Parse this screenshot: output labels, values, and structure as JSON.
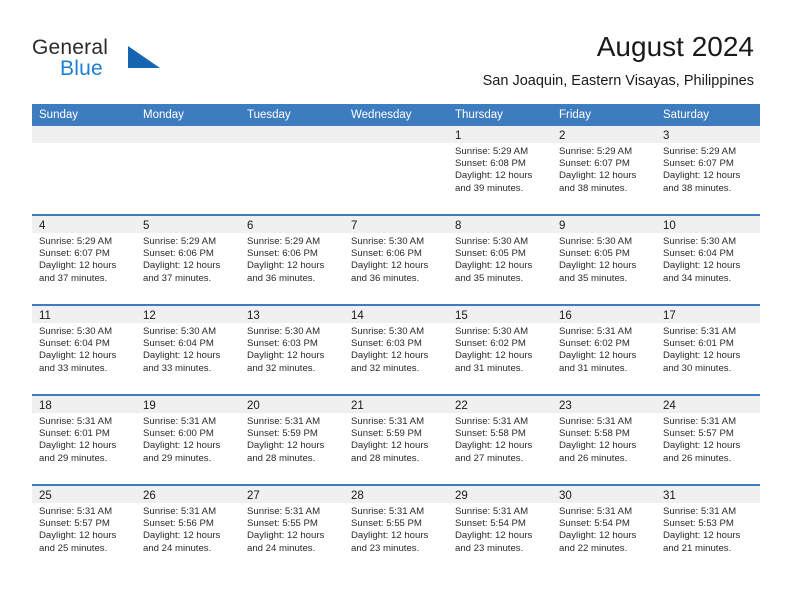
{
  "brand": {
    "line1": "General",
    "line2": "Blue",
    "logo_icon": "blue-triangle-icon",
    "accent_color": "#1f7fd0",
    "triangle_color": "#1565b0"
  },
  "header": {
    "title": "August 2024",
    "subtitle": "San Joaquin, Eastern Visayas, Philippines"
  },
  "calendar": {
    "header_bg": "#3d7cbf",
    "weekdays": [
      "Sunday",
      "Monday",
      "Tuesday",
      "Wednesday",
      "Thursday",
      "Friday",
      "Saturday"
    ],
    "weeks": [
      [
        {
          "day": "",
          "empty": true,
          "sunrise": "",
          "sunset": "",
          "daylight_line1": "",
          "daylight_line2": ""
        },
        {
          "day": "",
          "empty": true,
          "sunrise": "",
          "sunset": "",
          "daylight_line1": "",
          "daylight_line2": ""
        },
        {
          "day": "",
          "empty": true,
          "sunrise": "",
          "sunset": "",
          "daylight_line1": "",
          "daylight_line2": ""
        },
        {
          "day": "",
          "empty": true,
          "sunrise": "",
          "sunset": "",
          "daylight_line1": "",
          "daylight_line2": ""
        },
        {
          "day": "1",
          "empty": false,
          "sunrise": "Sunrise: 5:29 AM",
          "sunset": "Sunset: 6:08 PM",
          "daylight_line1": "Daylight: 12 hours",
          "daylight_line2": "and 39 minutes."
        },
        {
          "day": "2",
          "empty": false,
          "sunrise": "Sunrise: 5:29 AM",
          "sunset": "Sunset: 6:07 PM",
          "daylight_line1": "Daylight: 12 hours",
          "daylight_line2": "and 38 minutes."
        },
        {
          "day": "3",
          "empty": false,
          "sunrise": "Sunrise: 5:29 AM",
          "sunset": "Sunset: 6:07 PM",
          "daylight_line1": "Daylight: 12 hours",
          "daylight_line2": "and 38 minutes."
        }
      ],
      [
        {
          "day": "4",
          "empty": false,
          "sunrise": "Sunrise: 5:29 AM",
          "sunset": "Sunset: 6:07 PM",
          "daylight_line1": "Daylight: 12 hours",
          "daylight_line2": "and 37 minutes."
        },
        {
          "day": "5",
          "empty": false,
          "sunrise": "Sunrise: 5:29 AM",
          "sunset": "Sunset: 6:06 PM",
          "daylight_line1": "Daylight: 12 hours",
          "daylight_line2": "and 37 minutes."
        },
        {
          "day": "6",
          "empty": false,
          "sunrise": "Sunrise: 5:29 AM",
          "sunset": "Sunset: 6:06 PM",
          "daylight_line1": "Daylight: 12 hours",
          "daylight_line2": "and 36 minutes."
        },
        {
          "day": "7",
          "empty": false,
          "sunrise": "Sunrise: 5:30 AM",
          "sunset": "Sunset: 6:06 PM",
          "daylight_line1": "Daylight: 12 hours",
          "daylight_line2": "and 36 minutes."
        },
        {
          "day": "8",
          "empty": false,
          "sunrise": "Sunrise: 5:30 AM",
          "sunset": "Sunset: 6:05 PM",
          "daylight_line1": "Daylight: 12 hours",
          "daylight_line2": "and 35 minutes."
        },
        {
          "day": "9",
          "empty": false,
          "sunrise": "Sunrise: 5:30 AM",
          "sunset": "Sunset: 6:05 PM",
          "daylight_line1": "Daylight: 12 hours",
          "daylight_line2": "and 35 minutes."
        },
        {
          "day": "10",
          "empty": false,
          "sunrise": "Sunrise: 5:30 AM",
          "sunset": "Sunset: 6:04 PM",
          "daylight_line1": "Daylight: 12 hours",
          "daylight_line2": "and 34 minutes."
        }
      ],
      [
        {
          "day": "11",
          "empty": false,
          "sunrise": "Sunrise: 5:30 AM",
          "sunset": "Sunset: 6:04 PM",
          "daylight_line1": "Daylight: 12 hours",
          "daylight_line2": "and 33 minutes."
        },
        {
          "day": "12",
          "empty": false,
          "sunrise": "Sunrise: 5:30 AM",
          "sunset": "Sunset: 6:04 PM",
          "daylight_line1": "Daylight: 12 hours",
          "daylight_line2": "and 33 minutes."
        },
        {
          "day": "13",
          "empty": false,
          "sunrise": "Sunrise: 5:30 AM",
          "sunset": "Sunset: 6:03 PM",
          "daylight_line1": "Daylight: 12 hours",
          "daylight_line2": "and 32 minutes."
        },
        {
          "day": "14",
          "empty": false,
          "sunrise": "Sunrise: 5:30 AM",
          "sunset": "Sunset: 6:03 PM",
          "daylight_line1": "Daylight: 12 hours",
          "daylight_line2": "and 32 minutes."
        },
        {
          "day": "15",
          "empty": false,
          "sunrise": "Sunrise: 5:30 AM",
          "sunset": "Sunset: 6:02 PM",
          "daylight_line1": "Daylight: 12 hours",
          "daylight_line2": "and 31 minutes."
        },
        {
          "day": "16",
          "empty": false,
          "sunrise": "Sunrise: 5:31 AM",
          "sunset": "Sunset: 6:02 PM",
          "daylight_line1": "Daylight: 12 hours",
          "daylight_line2": "and 31 minutes."
        },
        {
          "day": "17",
          "empty": false,
          "sunrise": "Sunrise: 5:31 AM",
          "sunset": "Sunset: 6:01 PM",
          "daylight_line1": "Daylight: 12 hours",
          "daylight_line2": "and 30 minutes."
        }
      ],
      [
        {
          "day": "18",
          "empty": false,
          "sunrise": "Sunrise: 5:31 AM",
          "sunset": "Sunset: 6:01 PM",
          "daylight_line1": "Daylight: 12 hours",
          "daylight_line2": "and 29 minutes."
        },
        {
          "day": "19",
          "empty": false,
          "sunrise": "Sunrise: 5:31 AM",
          "sunset": "Sunset: 6:00 PM",
          "daylight_line1": "Daylight: 12 hours",
          "daylight_line2": "and 29 minutes."
        },
        {
          "day": "20",
          "empty": false,
          "sunrise": "Sunrise: 5:31 AM",
          "sunset": "Sunset: 5:59 PM",
          "daylight_line1": "Daylight: 12 hours",
          "daylight_line2": "and 28 minutes."
        },
        {
          "day": "21",
          "empty": false,
          "sunrise": "Sunrise: 5:31 AM",
          "sunset": "Sunset: 5:59 PM",
          "daylight_line1": "Daylight: 12 hours",
          "daylight_line2": "and 28 minutes."
        },
        {
          "day": "22",
          "empty": false,
          "sunrise": "Sunrise: 5:31 AM",
          "sunset": "Sunset: 5:58 PM",
          "daylight_line1": "Daylight: 12 hours",
          "daylight_line2": "and 27 minutes."
        },
        {
          "day": "23",
          "empty": false,
          "sunrise": "Sunrise: 5:31 AM",
          "sunset": "Sunset: 5:58 PM",
          "daylight_line1": "Daylight: 12 hours",
          "daylight_line2": "and 26 minutes."
        },
        {
          "day": "24",
          "empty": false,
          "sunrise": "Sunrise: 5:31 AM",
          "sunset": "Sunset: 5:57 PM",
          "daylight_line1": "Daylight: 12 hours",
          "daylight_line2": "and 26 minutes."
        }
      ],
      [
        {
          "day": "25",
          "empty": false,
          "sunrise": "Sunrise: 5:31 AM",
          "sunset": "Sunset: 5:57 PM",
          "daylight_line1": "Daylight: 12 hours",
          "daylight_line2": "and 25 minutes."
        },
        {
          "day": "26",
          "empty": false,
          "sunrise": "Sunrise: 5:31 AM",
          "sunset": "Sunset: 5:56 PM",
          "daylight_line1": "Daylight: 12 hours",
          "daylight_line2": "and 24 minutes."
        },
        {
          "day": "27",
          "empty": false,
          "sunrise": "Sunrise: 5:31 AM",
          "sunset": "Sunset: 5:55 PM",
          "daylight_line1": "Daylight: 12 hours",
          "daylight_line2": "and 24 minutes."
        },
        {
          "day": "28",
          "empty": false,
          "sunrise": "Sunrise: 5:31 AM",
          "sunset": "Sunset: 5:55 PM",
          "daylight_line1": "Daylight: 12 hours",
          "daylight_line2": "and 23 minutes."
        },
        {
          "day": "29",
          "empty": false,
          "sunrise": "Sunrise: 5:31 AM",
          "sunset": "Sunset: 5:54 PM",
          "daylight_line1": "Daylight: 12 hours",
          "daylight_line2": "and 23 minutes."
        },
        {
          "day": "30",
          "empty": false,
          "sunrise": "Sunrise: 5:31 AM",
          "sunset": "Sunset: 5:54 PM",
          "daylight_line1": "Daylight: 12 hours",
          "daylight_line2": "and 22 minutes."
        },
        {
          "day": "31",
          "empty": false,
          "sunrise": "Sunrise: 5:31 AM",
          "sunset": "Sunset: 5:53 PM",
          "daylight_line1": "Daylight: 12 hours",
          "daylight_line2": "and 21 minutes."
        }
      ]
    ]
  }
}
